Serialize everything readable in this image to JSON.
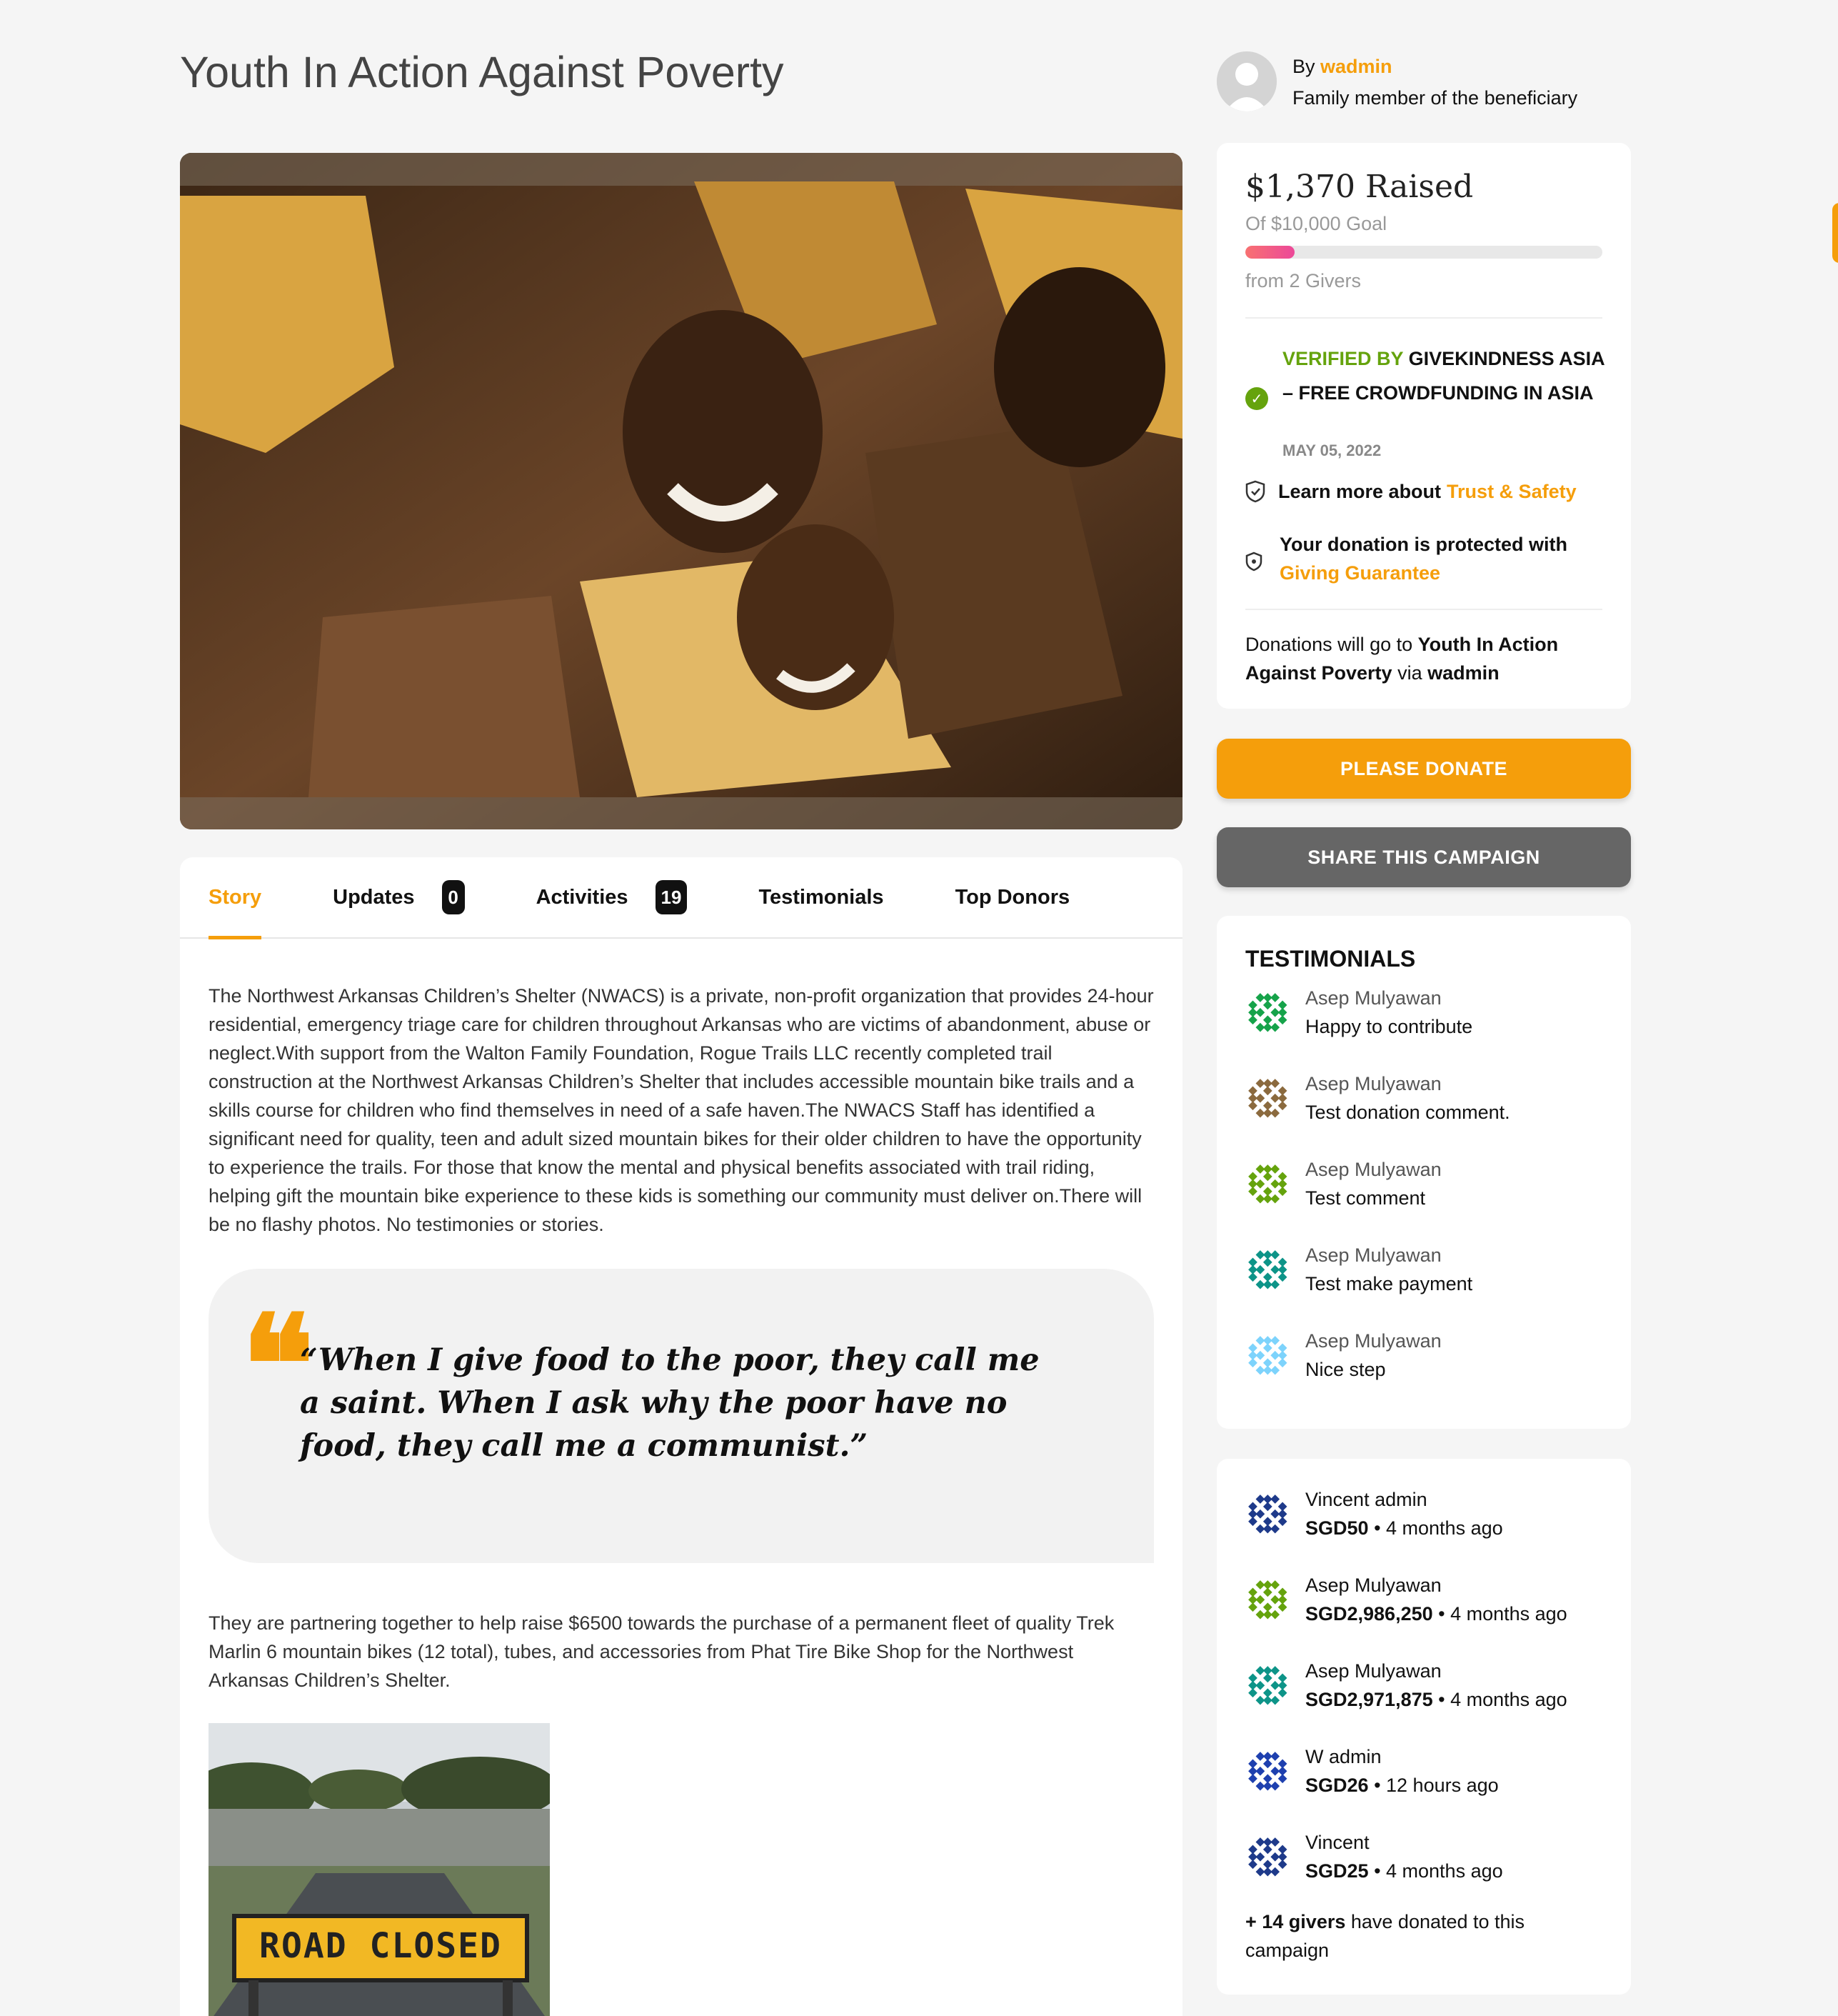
{
  "campaign": {
    "title": "Youth In Action Against Poverty"
  },
  "author": {
    "by_prefix": "By",
    "name": "wadmin",
    "relation": "Family member of the beneficiary"
  },
  "funding": {
    "raised": "$1,370 Raised",
    "goal": "Of $10,000 Goal",
    "progress_fraction": 0.137,
    "givers": "from 2 Givers",
    "verified_prefix": "VERIFIED BY",
    "verified_by": "GIVEKINDNESS ASIA – FREE CROWDFUNDING IN ASIA",
    "verified_date": "MAY 05, 2022",
    "trust_prefix": "Learn more about",
    "trust_link": "Trust & Safety",
    "guarantee_text": "Your donation is protected with",
    "guarantee_link": "Giving Guarantee",
    "donations_go_prefix": "Donations will go to",
    "donations_go_target": "Youth In Action Against Poverty",
    "donations_go_via": "via",
    "donations_go_account": "wadmin"
  },
  "buttons": {
    "donate": "PLEASE DONATE",
    "share": "SHARE THIS CAMPAIGN"
  },
  "tabs": [
    {
      "label": "Story",
      "count": ""
    },
    {
      "label": "Updates",
      "count": "0"
    },
    {
      "label": "Activities",
      "count": "19"
    },
    {
      "label": "Testimonials",
      "count": ""
    },
    {
      "label": "Top Donors",
      "count": ""
    }
  ],
  "story": {
    "paragraph1": "The Northwest Arkansas Children’s Shelter (NWACS) is a private, non-profit organization that provides 24-hour residential, emergency triage care for children throughout Arkansas who are victims of abandonment, abuse or neglect.With support from the Walton Family Foundation, Rogue Trails LLC recently completed trail construction at the Northwest Arkansas Children’s Shelter that includes accessible mountain bike trails and a skills course for children who find themselves in need of a safe haven.The NWACS Staff has identified a significant need for quality, teen and adult sized mountain bikes for their older children to have the opportunity to experience the trails. For those that know the mental and physical benefits associated with trail riding, helping gift the mountain bike experience to these kids is something our community must deliver on.There will be no flashy photos. No testimonies or stories.",
    "quote": "“When I give food to the poor, they call me a saint. When I ask why the poor have no food, they call me a communist.”",
    "paragraph2": "They are partnering together to help raise $6500 towards the purchase of a permanent fleet of quality Trek Marlin 6 mountain bikes (12 total), tubes, and accessories from Phat Tire Bike Shop for the Northwest Arkansas Children’s Shelter.",
    "road_sign": "ROAD CLOSED"
  },
  "testimonials": {
    "title": "TESTIMONIALS",
    "items": [
      {
        "name": "Asep Mulyawan",
        "comment": "Happy to contribute",
        "color": "#16a34a"
      },
      {
        "name": "Asep Mulyawan",
        "comment": "Test donation comment.",
        "color": "#8b6a3e"
      },
      {
        "name": "Asep Mulyawan",
        "comment": "Test comment",
        "color": "#65a30d"
      },
      {
        "name": "Asep Mulyawan",
        "comment": "Test make payment",
        "color": "#0d9488"
      },
      {
        "name": "Asep Mulyawan",
        "comment": "Nice step",
        "color": "#7dd3fc"
      }
    ]
  },
  "donors": {
    "items": [
      {
        "name": "Vincent admin",
        "amount": "SGD50",
        "time": "• 4 months ago",
        "color": "#1e3a8a"
      },
      {
        "name": "Asep Mulyawan",
        "amount": "SGD2,986,250",
        "time": "• 4 months ago",
        "color": "#65a30d"
      },
      {
        "name": "Asep Mulyawan",
        "amount": "SGD2,971,875",
        "time": "• 4 months ago",
        "color": "#0d9488"
      },
      {
        "name": "W admin",
        "amount": "SGD26",
        "time": "• 12 hours ago",
        "color": "#1e40af"
      },
      {
        "name": "Vincent",
        "amount": "SGD25",
        "time": "• 4 months ago",
        "color": "#1e3a8a"
      }
    ],
    "more_count": "+ 14 givers",
    "more_text": "have donated to this campaign"
  },
  "colors": {
    "accent": "#f59e0b",
    "verified_green": "#65a30d",
    "share_gray": "#666666"
  }
}
